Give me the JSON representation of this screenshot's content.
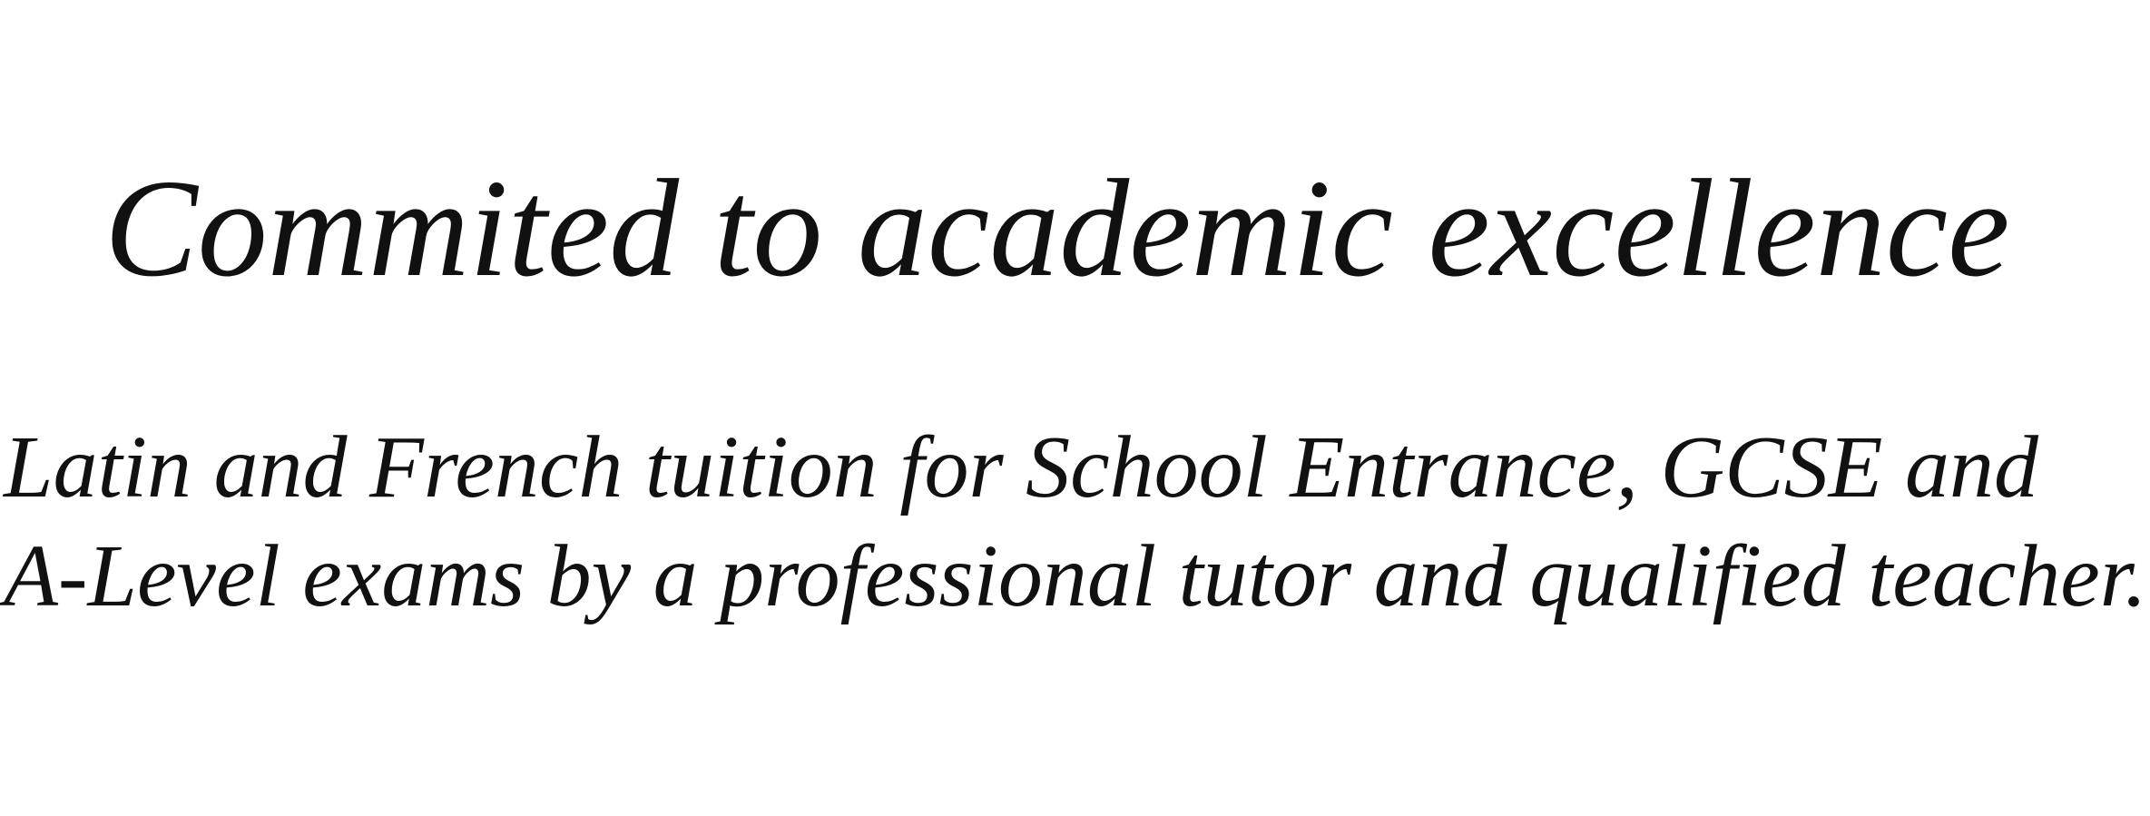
{
  "hero": {
    "headline": "Commited to academic excellence",
    "subtext_lines": [
      "Latin and French tuition for School Entrance, GCSE and",
      "A-Level exams by a professional tutor and qualified teacher."
    ]
  }
}
